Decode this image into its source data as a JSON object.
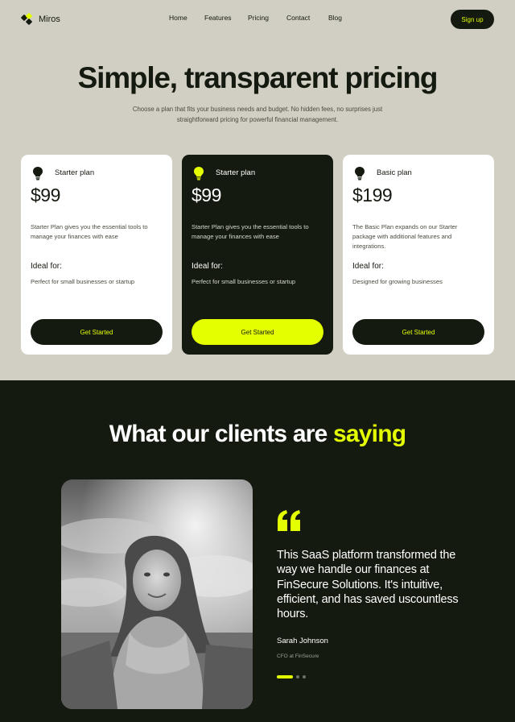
{
  "nav": {
    "logo_text": "Miros",
    "links": [
      "Home",
      "Features",
      "Pricing",
      "Contact",
      "Blog"
    ],
    "signup_label": "Sign up"
  },
  "hero": {
    "title": "Simple, transparent pricing",
    "subtitle": "Choose a plan that fits your business needs and budget. No hidden fees, no surprises just straightforward pricing for powerful financial management."
  },
  "plans": [
    {
      "name": "Starter plan",
      "price": "$99",
      "description": "Starter Plan gives you the essential tools to manage your finances with ease",
      "ideal_label": "Ideal for:",
      "ideal_text": "Perfect for small businesses or startup",
      "cta": "Get Started"
    },
    {
      "name": "Starter plan",
      "price": "$99",
      "description": "Starter Plan gives you the essential tools to manage your finances with ease",
      "ideal_label": "Ideal for:",
      "ideal_text": "Perfect for small businesses or startup",
      "cta": "Get Started"
    },
    {
      "name": "Basic plan",
      "price": "$199",
      "description": "The Basic Plan expands on our Starter package with additional features and integrations.",
      "ideal_label": "Ideal for:",
      "ideal_text": "Designed for growing businesses",
      "cta": "Get Started"
    }
  ],
  "testimonials": {
    "title_main": "What our clients are ",
    "title_highlight": "saying",
    "quote": "This SaaS platform transformed the way we handle our finances at FinSecure Solutions. It's intuitive, efficient, and has saved uscountless hours.",
    "author": "Sarah Johnson",
    "role": "CFO at FinSecure",
    "carousel_active_index": 0,
    "carousel_count": 3
  },
  "colors": {
    "accent": "#e4ff00",
    "dark": "#141a10",
    "background": "#d1cec3",
    "card": "#ffffff"
  },
  "icons": {
    "logo": "logo-mark-icon",
    "plan": "lightbulb-icon",
    "quote": "quote-icon"
  }
}
